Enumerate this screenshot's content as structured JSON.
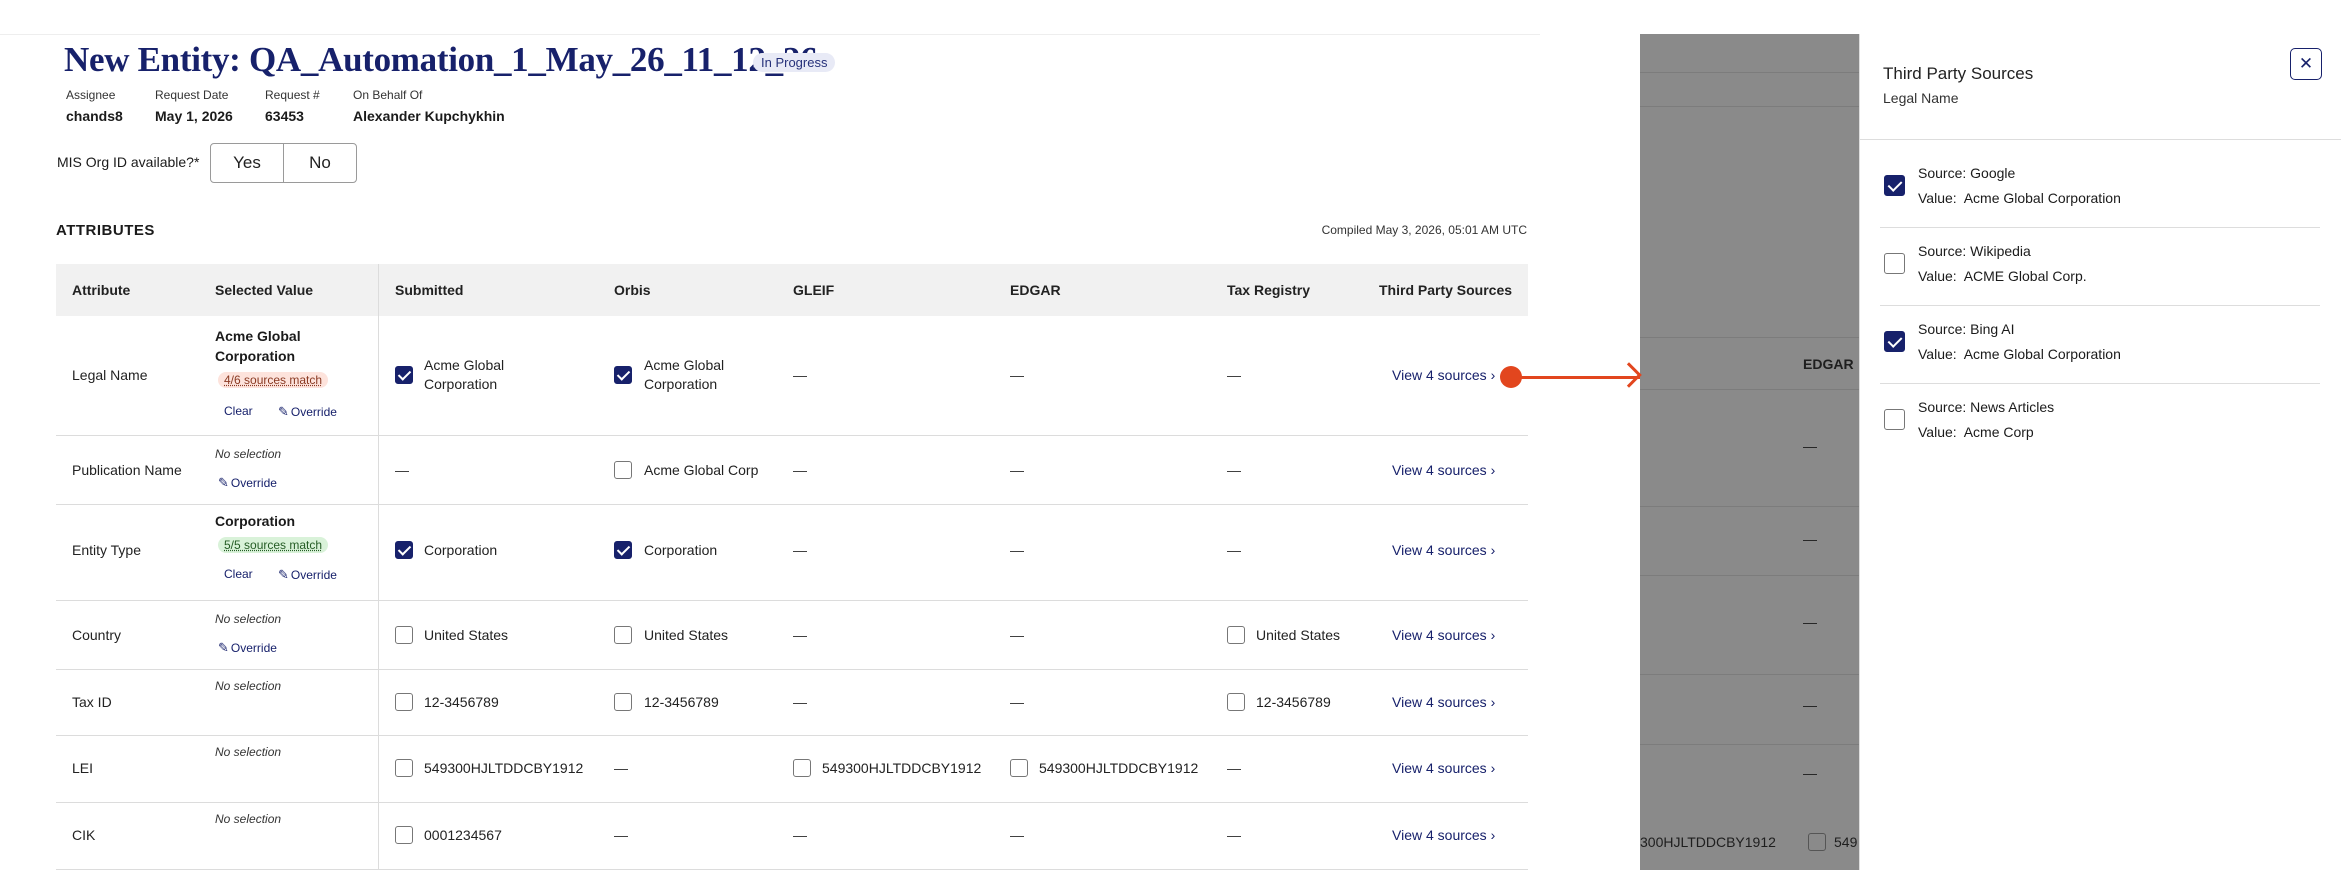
{
  "header": {
    "title": "New Entity: QA_Automation_1_May_26_11_12_26",
    "status_badge": "In Progress",
    "meta": [
      {
        "label": "Assignee",
        "value": "chands8"
      },
      {
        "label": "Request Date",
        "value": "May 1, 2026"
      },
      {
        "label": "Request #",
        "value": "63453"
      },
      {
        "label": "On Behalf Of",
        "value": "Alexander Kupchykhin"
      }
    ]
  },
  "mis_question": {
    "label": "MIS Org ID available?*",
    "yes": "Yes",
    "no": "No"
  },
  "attributes": {
    "section_title": "ATTRIBUTES",
    "compiled": "Compiled May 3, 2026, 05:01 AM UTC",
    "columns": [
      "Attribute",
      "Selected Value",
      "Submitted",
      "Orbis",
      "GLEIF",
      "EDGAR",
      "Tax Registry",
      "Third Party Sources"
    ],
    "clear_label": "Clear",
    "override_label": "Override",
    "no_selection": "No selection",
    "dash": "—",
    "view_link": "View 4 sources",
    "rows": [
      {
        "name": "Legal Name",
        "selected": "Acme Global Corporation",
        "match": "4/6 sources match",
        "submitted": "Acme Global Corporation",
        "orbis": "Acme Global Corporation"
      },
      {
        "name": "Publication Name",
        "orbis": "Acme Global Corp"
      },
      {
        "name": "Entity Type",
        "selected": "Corporation",
        "match": "5/5 sources match",
        "submitted": "Corporation",
        "orbis": "Corporation"
      },
      {
        "name": "Country",
        "submitted": "United States",
        "orbis": "United States",
        "tax": "United States"
      },
      {
        "name": "Tax ID",
        "submitted": "12-3456789",
        "orbis": "12-3456789",
        "tax": "12-3456789"
      },
      {
        "name": "LEI",
        "submitted": "549300HJLTDDCBY1912",
        "gleif": "549300HJLTDDCBY1912",
        "edgar": "549300HJLTDDCBY1912"
      },
      {
        "name": "CIK",
        "submitted": "0001234567"
      }
    ]
  },
  "overlay": {
    "edgar_header": "EDGAR",
    "partial_lei": "300HJLTDDCBY1912",
    "partial_lei2": "549"
  },
  "drawer": {
    "title": "Third Party Sources",
    "subtitle": "Legal Name",
    "close_icon": "close-icon",
    "source_prefix": "Source:",
    "value_prefix": "Value:",
    "sources": [
      {
        "source": "Google",
        "value": "Acme Global Corporation",
        "checked": true
      },
      {
        "source": "Wikipedia",
        "value": "ACME Global Corp.",
        "checked": false
      },
      {
        "source": "Bing AI",
        "value": "Acme Global Corporation",
        "checked": true
      },
      {
        "source": "News Articles",
        "value": "Acme Corp",
        "checked": false
      }
    ]
  },
  "colors": {
    "brand": "#17216b",
    "arrow": "#e2461e",
    "overlay": "#8a8a8a"
  }
}
